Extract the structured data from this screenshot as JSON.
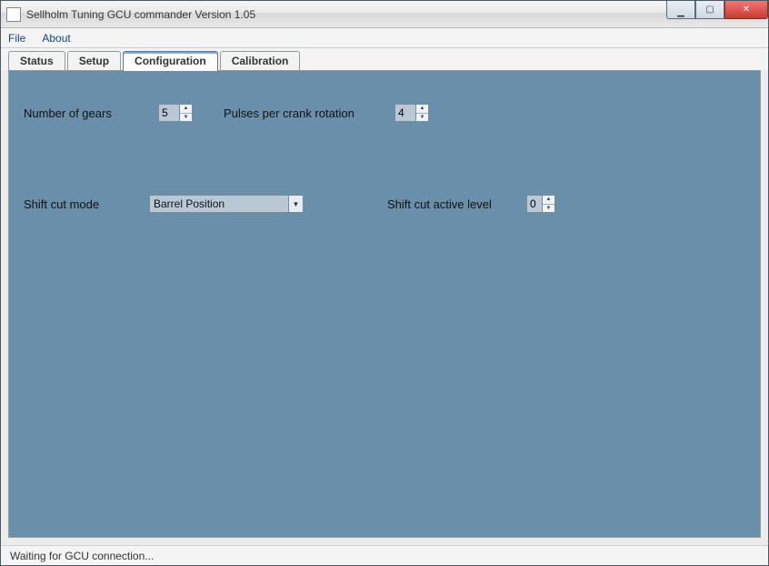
{
  "window": {
    "title": "Sellholm Tuning GCU commander Version 1.05"
  },
  "menu": {
    "file": "File",
    "about": "About"
  },
  "tabs": {
    "status": "Status",
    "setup": "Setup",
    "configuration": "Configuration",
    "calibration": "Calibration",
    "active": "configuration"
  },
  "config": {
    "numGears": {
      "label": "Number of gears",
      "value": "5"
    },
    "pulses": {
      "label": "Pulses per crank rotation",
      "value": "4"
    },
    "shiftCutMode": {
      "label": "Shift cut mode",
      "value": "Barrel Position"
    },
    "shiftCutLevel": {
      "label": "Shift cut active level",
      "value": "0"
    }
  },
  "status": {
    "text": "Waiting for GCU connection..."
  }
}
